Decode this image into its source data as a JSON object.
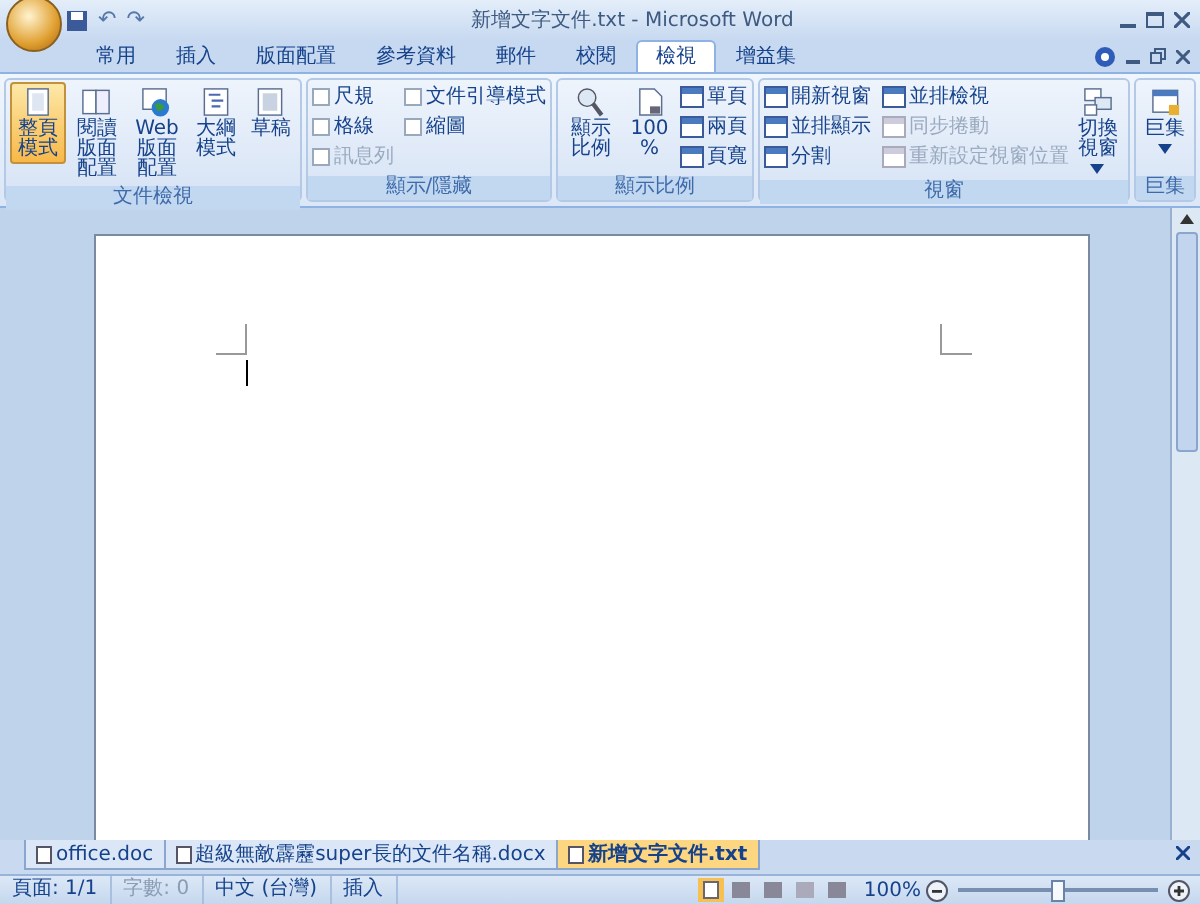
{
  "window": {
    "title": "新增文字文件.txt - Microsoft Word"
  },
  "quick_access": {
    "undo": "↶",
    "redo": "↷"
  },
  "tabs": [
    {
      "label": "常用",
      "selected": false
    },
    {
      "label": "插入",
      "selected": false
    },
    {
      "label": "版面配置",
      "selected": false
    },
    {
      "label": "參考資料",
      "selected": false
    },
    {
      "label": "郵件",
      "selected": false
    },
    {
      "label": "校閱",
      "selected": false
    },
    {
      "label": "檢視",
      "selected": true
    },
    {
      "label": "增益集",
      "selected": false
    }
  ],
  "ribbon_groups": [
    {
      "label": "文件檢視",
      "items": [
        {
          "kind": "large",
          "label": "整頁模式",
          "selected": true
        },
        {
          "kind": "large",
          "label": "閱讀版面配置",
          "selected": false
        },
        {
          "kind": "large",
          "label": "Web 版面配置",
          "selected": false
        },
        {
          "kind": "large",
          "label": "大綱模式",
          "selected": false
        },
        {
          "kind": "large",
          "label": "草稿",
          "selected": false
        }
      ]
    },
    {
      "label": "顯示/隱藏",
      "items": [
        {
          "kind": "check",
          "label": "尺規",
          "checked": false,
          "disabled": false
        },
        {
          "kind": "check",
          "label": "格線",
          "checked": false,
          "disabled": false
        },
        {
          "kind": "check",
          "label": "訊息列",
          "checked": false,
          "disabled": true
        },
        {
          "kind": "check",
          "label": "文件引導模式",
          "checked": false,
          "disabled": false
        },
        {
          "kind": "check",
          "label": "縮圖",
          "checked": false,
          "disabled": false
        }
      ]
    },
    {
      "label": "顯示比例",
      "items": [
        {
          "kind": "large",
          "label": "顯示比例",
          "selected": false
        },
        {
          "kind": "large",
          "label": "100%",
          "selected": false
        },
        {
          "kind": "small",
          "label": "單頁",
          "disabled": false
        },
        {
          "kind": "small",
          "label": "兩頁",
          "disabled": false
        },
        {
          "kind": "small",
          "label": "頁寬",
          "disabled": false
        }
      ]
    },
    {
      "label": "視窗",
      "items": [
        {
          "kind": "small",
          "label": "開新視窗",
          "disabled": false
        },
        {
          "kind": "small",
          "label": "並排顯示",
          "disabled": false
        },
        {
          "kind": "small",
          "label": "分割",
          "disabled": false
        },
        {
          "kind": "small",
          "label": "並排檢視",
          "disabled": false
        },
        {
          "kind": "small",
          "label": "同步捲動",
          "disabled": true
        },
        {
          "kind": "small",
          "label": "重新設定視窗位置",
          "disabled": true
        },
        {
          "kind": "large",
          "label": "切換視窗",
          "selected": false,
          "dropdown": true
        }
      ]
    },
    {
      "label": "巨集",
      "items": [
        {
          "kind": "large",
          "label": "巨集",
          "selected": false,
          "dropdown": true
        }
      ]
    }
  ],
  "document_tabs": [
    {
      "label": "office.doc",
      "selected": false
    },
    {
      "label": "超級無敵霹靂super長的文件名稱.docx",
      "selected": false
    },
    {
      "label": "新增文字文件.txt",
      "selected": true
    }
  ],
  "status_bar": [
    {
      "text": "頁面: 1/1",
      "disabled": false
    },
    {
      "text": "字數: 0",
      "disabled": true
    },
    {
      "text": "中文 (台灣)",
      "disabled": false
    },
    {
      "text": "插入",
      "disabled": false
    }
  ],
  "zoom": {
    "reading": "100%",
    "level": 0.5
  }
}
